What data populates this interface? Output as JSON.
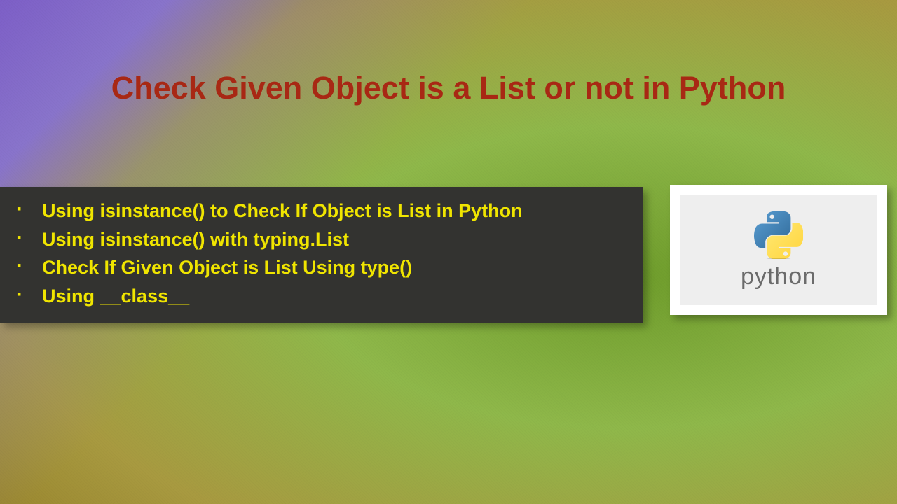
{
  "title": "Check Given Object is a List or not in Python",
  "bullets": [
    "Using isinstance() to Check If Object is List in Python",
    "Using isinstance() with typing.List",
    "Check If Given Object is List Using type()",
    "Using __class__"
  ],
  "logo": {
    "text": "python",
    "name": "python-logo"
  }
}
